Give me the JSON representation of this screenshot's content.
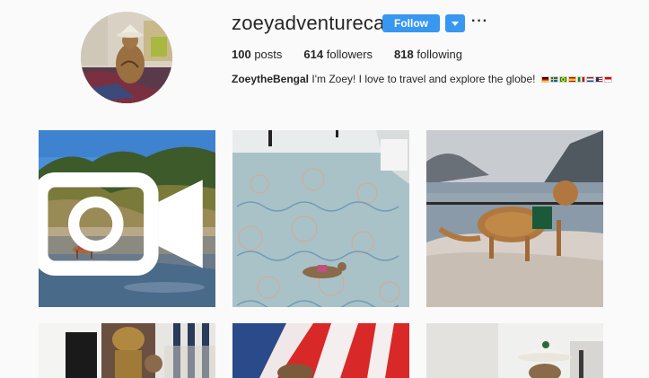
{
  "profile": {
    "username": "zoeyadventurecat",
    "follow_label": "Follow",
    "more_label": "···",
    "stats": {
      "posts_count": "100",
      "posts_label": "posts",
      "followers_count": "614",
      "followers_label": "followers",
      "following_count": "818",
      "following_label": "following"
    },
    "bio": {
      "name": "ZoeytheBengal",
      "text": "I'm Zoey! I love to travel and explore the globe!",
      "flags": [
        "germany",
        "sweden",
        "brazil",
        "spain",
        "italy",
        "netherlands",
        "usa",
        "indonesia"
      ]
    }
  },
  "grid": {
    "posts": [
      {
        "id": "post-beach",
        "icon": "video-icon"
      },
      {
        "id": "post-airport"
      },
      {
        "id": "post-lake"
      },
      {
        "id": "post-statue"
      },
      {
        "id": "post-blanket"
      },
      {
        "id": "post-hat"
      }
    ]
  },
  "colors": {
    "accent": "#3897f0",
    "background": "#fafafa",
    "text": "#262626"
  }
}
